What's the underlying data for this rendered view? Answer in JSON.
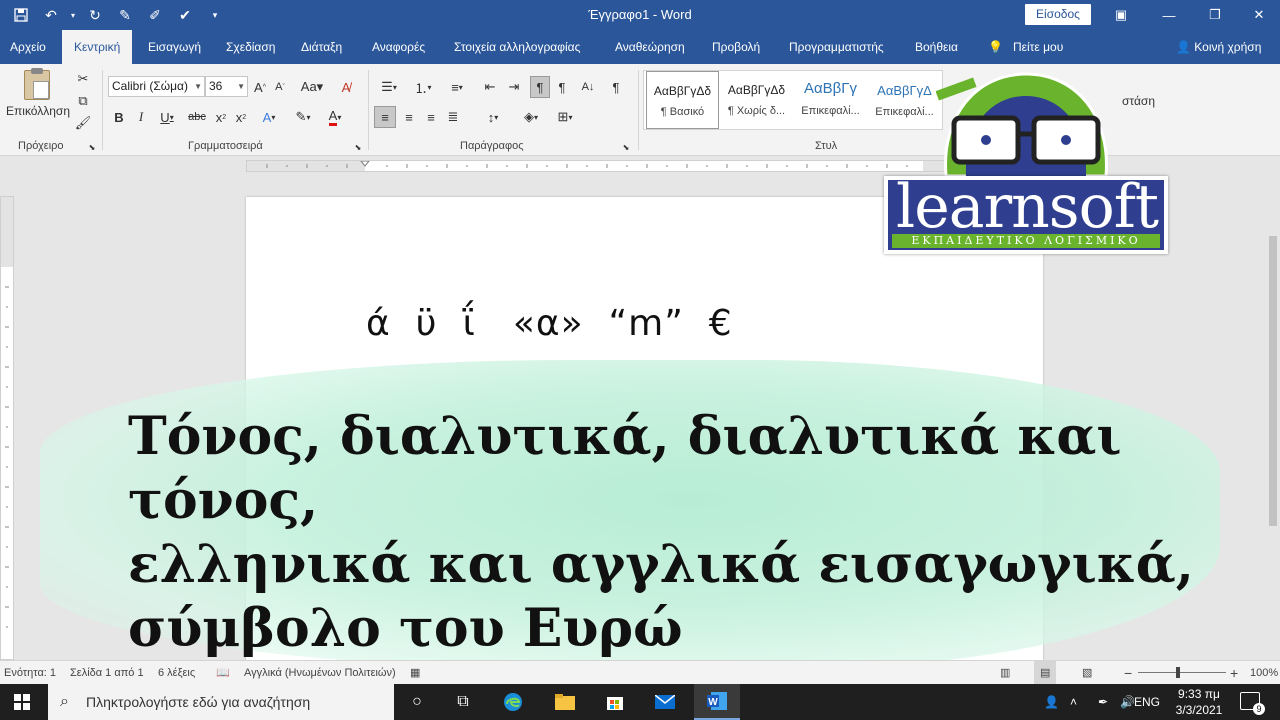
{
  "window": {
    "title": "Έγγραφο1  -  Word",
    "signin_label": "Είσοδος"
  },
  "tabs": [
    "Αρχείο",
    "Κεντρική",
    "Εισαγωγή",
    "Σχεδίαση",
    "Διάταξη",
    "Αναφορές",
    "Στοιχεία αλληλογραφίας",
    "Αναθεώρηση",
    "Προβολή",
    "Προγραμματιστής",
    "Βοήθεια",
    "Πείτε μου"
  ],
  "share_label": "Κοινή χρήση",
  "ribbon": {
    "paste_label": "Επικόλληση",
    "font_name": "Calibri (Σώμα)",
    "font_size": "36",
    "groups": {
      "clipboard": "Πρόχειρο",
      "font": "Γραμματοσειρά",
      "paragraph": "Παράγραφος",
      "styles": "Στυλ",
      "editing_fragment": "στάση"
    },
    "styles": [
      {
        "sample": "ΑαΒβΓγΔδ",
        "name": "¶ Βασικό"
      },
      {
        "sample": "ΑαΒβΓγΔδ",
        "name": "¶ Χωρίς δ..."
      },
      {
        "sample": "ΑαΒβΓγ",
        "name": "Επικεφαλί..."
      },
      {
        "sample": "ΑαΒβΓγΔ",
        "name": "Επικεφαλί..."
      }
    ]
  },
  "document": {
    "symbols_line": "ά  ϋ  ΐ   «α»  “m”  €"
  },
  "headline": {
    "line1": "Τόνος, διαλυτικά, διαλυτικά και τόνος,",
    "line2": "ελληνικά και αγγλικά εισαγωγικά,",
    "line3": "σύμβολο του Ευρώ"
  },
  "logo": {
    "word": "learnsoft",
    "subtitle": "ΕΚΠΑΙΔΕΥΤΙΚΟ ΛΟΓΙΣΜΙΚΟ",
    "colors": {
      "blue": "#2f3e8f",
      "green": "#6ab42d"
    }
  },
  "statusbar": {
    "section": "Ενότητα: 1",
    "page": "Σελίδα 1 από 1",
    "words": "6 λέξεις",
    "language": "Αγγλικά (Ηνωμένων Πολιτειών)",
    "zoom": "100%"
  },
  "taskbar": {
    "search_placeholder": "Πληκτρολογήστε εδώ για αναζήτηση",
    "lang": "ENG",
    "time": "9:33 πμ",
    "date": "3/3/2021",
    "notifications": "9"
  },
  "colors": {
    "accent": "#2b579a"
  }
}
